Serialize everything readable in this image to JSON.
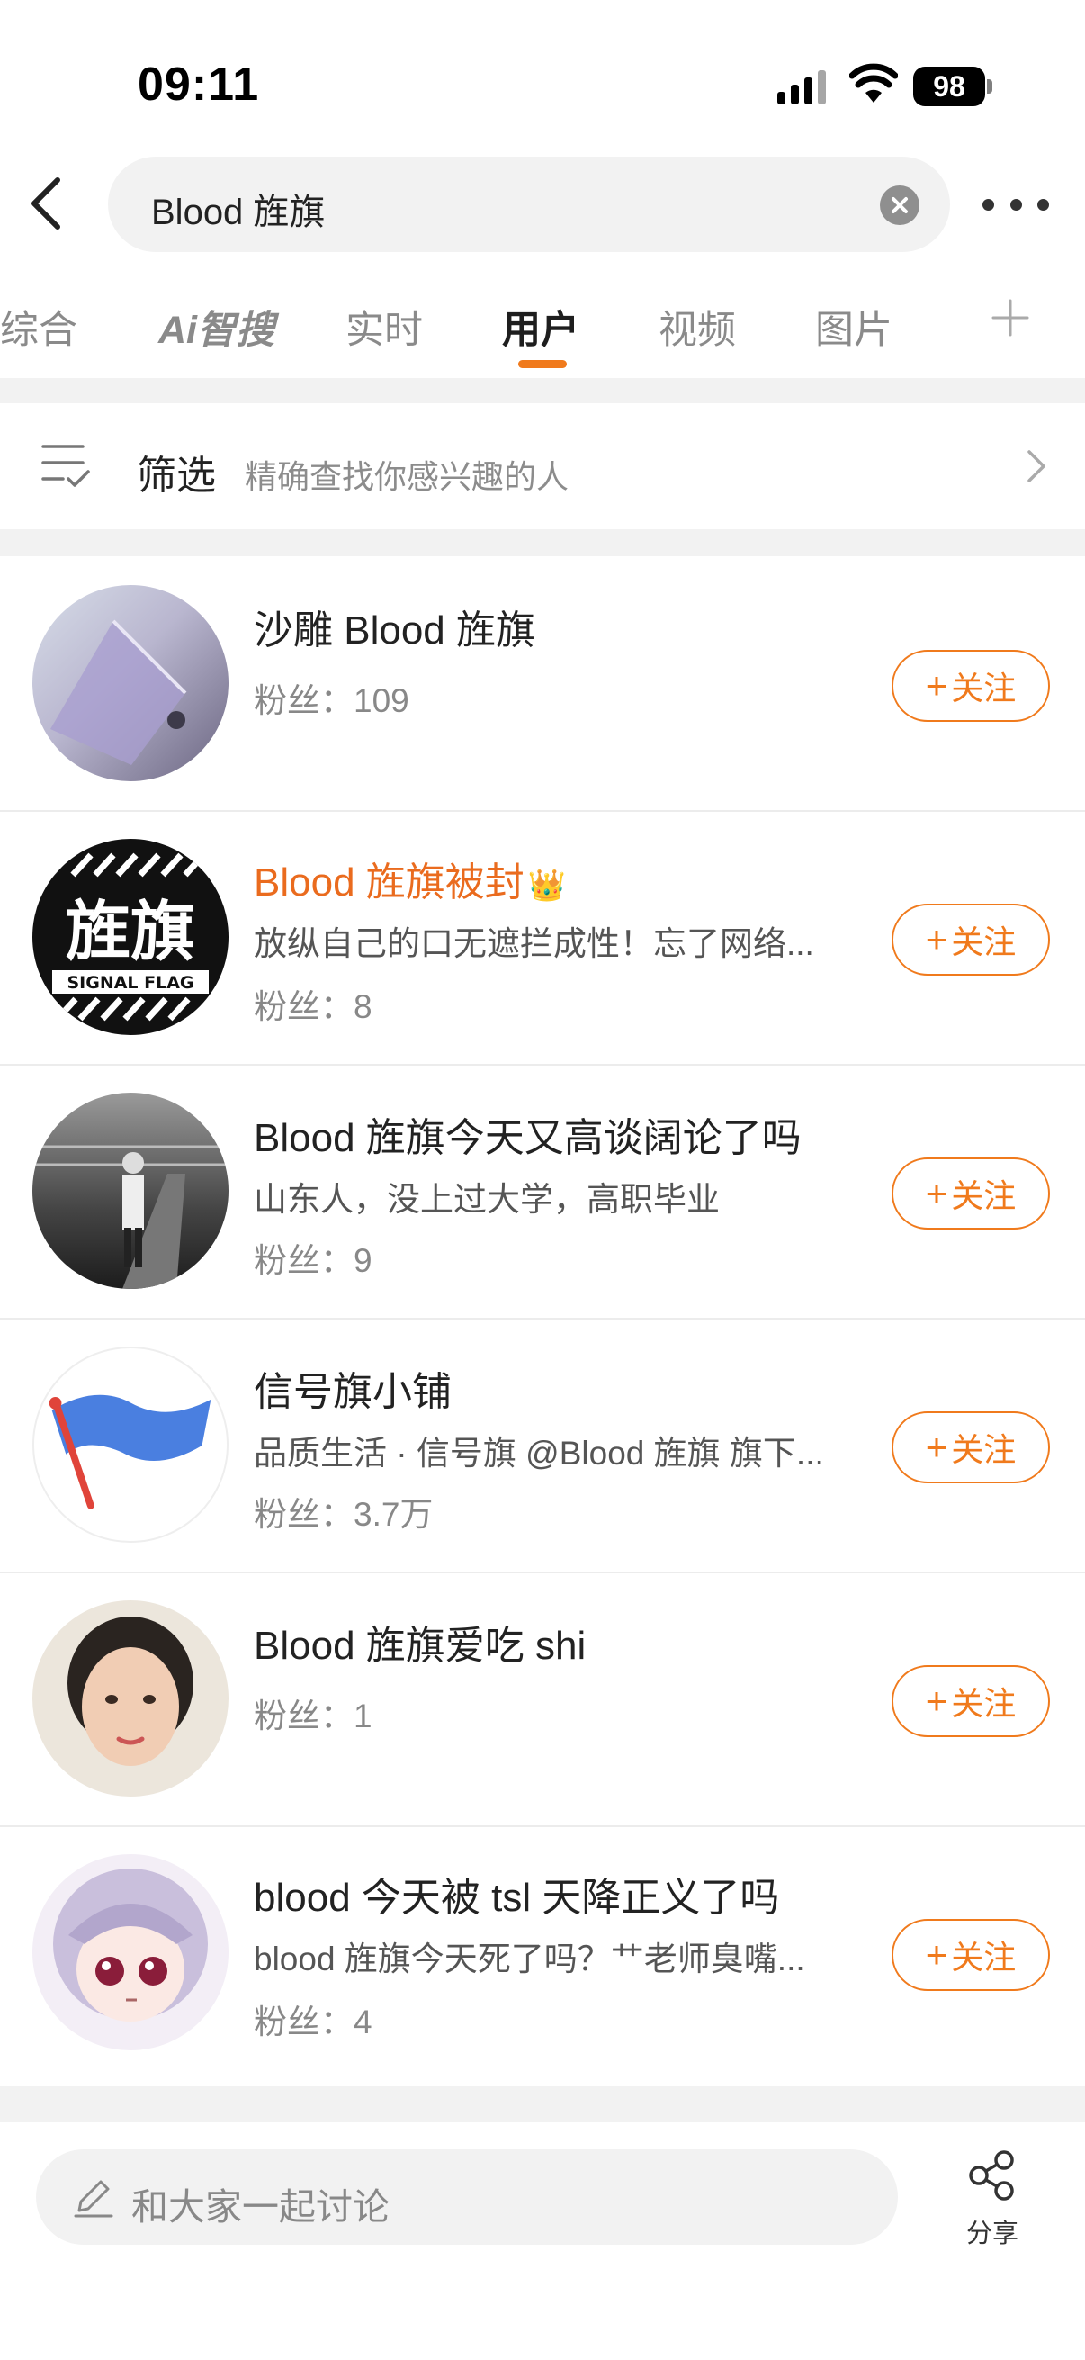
{
  "status": {
    "time": "09:11",
    "battery": "98"
  },
  "search": {
    "query": "Blood 旌旗"
  },
  "tabs": [
    {
      "label": "综合"
    },
    {
      "label": "Ai智搜"
    },
    {
      "label": "实时"
    },
    {
      "label": "用户"
    },
    {
      "label": "视频"
    },
    {
      "label": "图片"
    }
  ],
  "filter": {
    "label": "筛选",
    "hint": "精确查找你感兴趣的人"
  },
  "users": [
    {
      "name": "沙雕 Blood 旌旗",
      "desc": "",
      "fans": "粉丝：109",
      "follow": "关注"
    },
    {
      "name": "Blood 旌旗被封",
      "desc": "放纵自己的口无遮拦成性！忘了网络...",
      "fans": "粉丝：8",
      "follow": "关注",
      "avatar_text": "旌旗",
      "avatar_subtext": "SIGNAL FLAG"
    },
    {
      "name": "Blood 旌旗今天又高谈阔论了吗",
      "desc": "山东人，没上过大学，高职毕业",
      "fans": "粉丝：9",
      "follow": "关注"
    },
    {
      "name": "信号旗小铺",
      "desc": "品质生活 · 信号旗 @Blood 旌旗 旗下...",
      "fans": "粉丝：3.7万",
      "follow": "关注"
    },
    {
      "name": "Blood 旌旗爱吃 shi",
      "desc": "",
      "fans": "粉丝：1",
      "follow": "关注"
    },
    {
      "name": "blood 今天被 tsl 天降正义了吗",
      "desc": "blood 旌旗今天死了吗？艹老师臭嘴...",
      "fans": "粉丝：4",
      "follow": "关注"
    }
  ],
  "bottom": {
    "placeholder": "和大家一起讨论",
    "share": "分享"
  },
  "colors": {
    "accent": "#f07a1c",
    "vip_name": "#ea6b1e",
    "background_gap": "#f2f2f2"
  }
}
